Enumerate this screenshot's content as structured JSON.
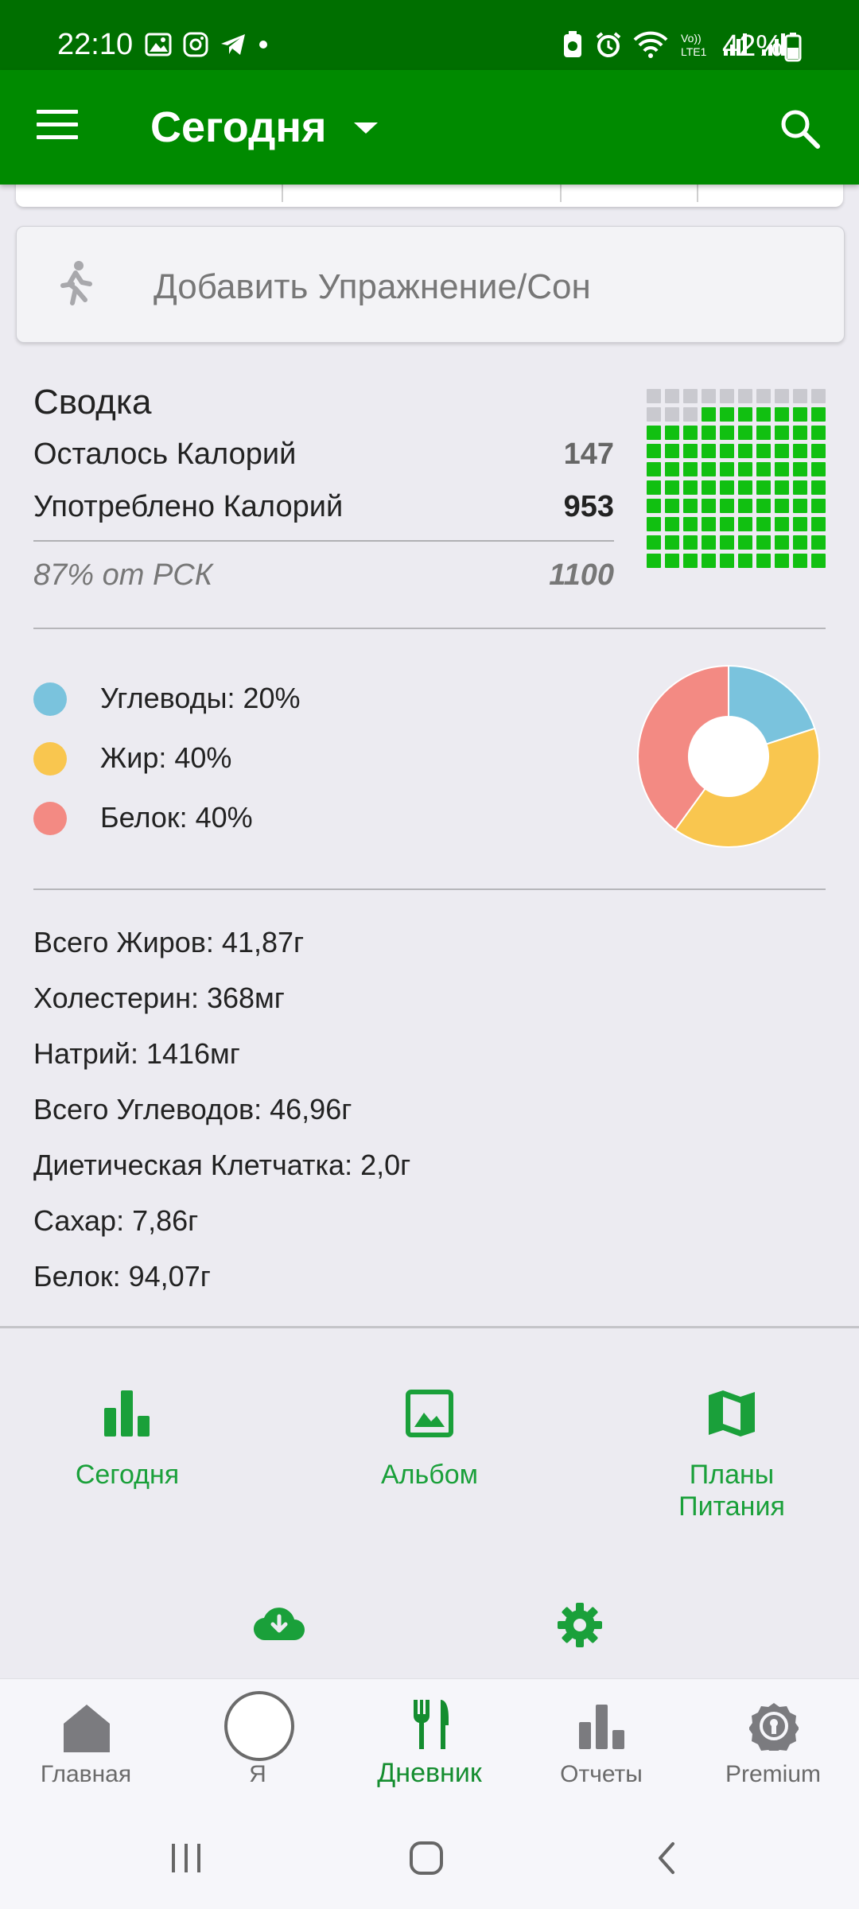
{
  "status_bar": {
    "time": "22:10",
    "battery": "42%"
  },
  "app_bar": {
    "title": "Сегодня"
  },
  "exercise": {
    "label": "Добавить Упражнение/Сон"
  },
  "summary": {
    "title": "Сводка",
    "remaining_label": "Осталось Калорий",
    "remaining_value": "147",
    "consumed_label": "Употреблено Калорий",
    "consumed_value": "953",
    "percent_label": "87% от РСК",
    "goal_value": "1100",
    "progress_fraction": 0.87,
    "filled_color": "#11c011",
    "empty_color": "#c9c9cf"
  },
  "macros": [
    {
      "label": "Углеводы: 20%",
      "percent": 20,
      "color": "#7ac3dd"
    },
    {
      "label": "Жир: 40%",
      "percent": 40,
      "color": "#f9c64f"
    },
    {
      "label": "Белок: 40%",
      "percent": 40,
      "color": "#f38a83"
    }
  ],
  "nutrients": [
    "Всего Жиров: 41,87г",
    "Холестерин: 368мг",
    "Натрий: 1416мг",
    "Всего Углеводов: 46,96г",
    "Диетическая Клетчатка: 2,0г",
    "Сахар: 7,86г",
    "Белок: 94,07г"
  ],
  "quick_links": [
    {
      "label": "Сегодня",
      "icon": "bar-chart-icon"
    },
    {
      "label": "Альбом",
      "icon": "image-icon"
    },
    {
      "label": "Планы\nПитания",
      "icon": "map-icon"
    }
  ],
  "quick_links_row2": [
    {
      "icon": "cloud-download-icon"
    },
    {
      "icon": "gear-icon"
    }
  ],
  "bottom_nav": [
    {
      "label": "Главная",
      "icon": "home-icon"
    },
    {
      "label": "Я",
      "icon": "avatar-icon"
    },
    {
      "label": "Дневник",
      "icon": "fork-knife-icon",
      "active": true
    },
    {
      "label": "Отчеты",
      "icon": "bar-chart-icon"
    },
    {
      "label": "Premium",
      "icon": "premium-badge-icon"
    }
  ],
  "accent_color": "#008a00"
}
